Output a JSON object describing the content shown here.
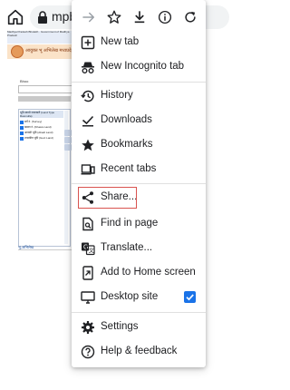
{
  "browser": {
    "url_text": "mpbh",
    "icons": [
      "home-icon",
      "lock-icon"
    ]
  },
  "background_page": {
    "header_text": "Madhya Pradesh Bhulekh · Government of Madhya Pradesh",
    "title": "आयुक्त भू अभिलेख मध्यप्रदेश",
    "label": "Bhoo",
    "panel_head": "भूमि स्वामी जानकारी (Land Type Rasmulla)",
    "tree_items": [
      "सर्वे नं. (Survey)",
      "खसरा नं. (Khasra Land)",
      "आबादी भूमि (Abadi Land)",
      "शासकीय भूमि (Govt Land)"
    ],
    "footer_link": "भू-अभिलेख"
  },
  "menu": {
    "top_icons": [
      "forward-arrow-icon",
      "star-icon",
      "download-icon",
      "info-icon",
      "refresh-icon"
    ],
    "items": [
      {
        "label": "New tab",
        "icon": "new-tab-icon"
      },
      {
        "label": "New Incognito tab",
        "icon": "incognito-icon"
      },
      {
        "label": "History",
        "icon": "history-icon"
      },
      {
        "label": "Downloads",
        "icon": "downloads-icon"
      },
      {
        "label": "Bookmarks",
        "icon": "bookmarks-icon"
      },
      {
        "label": "Recent tabs",
        "icon": "recent-tabs-icon"
      },
      {
        "label": "Share...",
        "icon": "share-icon"
      },
      {
        "label": "Find in page",
        "icon": "find-in-page-icon"
      },
      {
        "label": "Translate...",
        "icon": "translate-icon"
      },
      {
        "label": "Add to Home screen",
        "icon": "add-to-home-icon"
      },
      {
        "label": "Desktop site",
        "icon": "desktop-site-icon",
        "checked": true
      },
      {
        "label": "Settings",
        "icon": "settings-icon"
      },
      {
        "label": "Help & feedback",
        "icon": "help-icon"
      }
    ],
    "highlight_color": "#d9534f",
    "accent_color": "#1a73e8"
  }
}
